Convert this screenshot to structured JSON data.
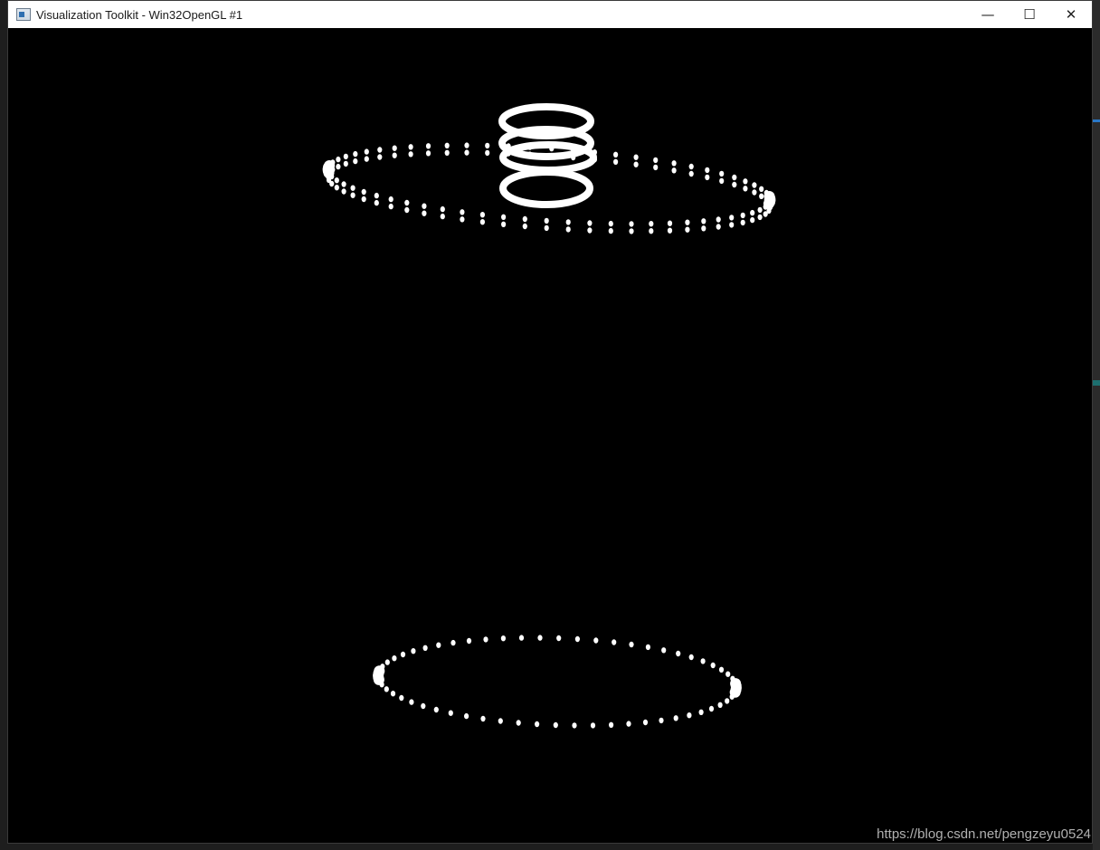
{
  "window": {
    "title": "Visualization Toolkit - Win32OpenGL #1",
    "icon": "vtk-app-icon",
    "controls": {
      "minimize": "—",
      "maximize": "☐",
      "close": "✕"
    }
  },
  "render": {
    "background_color": "#000000",
    "geometry_color": "#ffffff"
  },
  "watermark": "https://blog.csdn.net/pengzeyu0524"
}
